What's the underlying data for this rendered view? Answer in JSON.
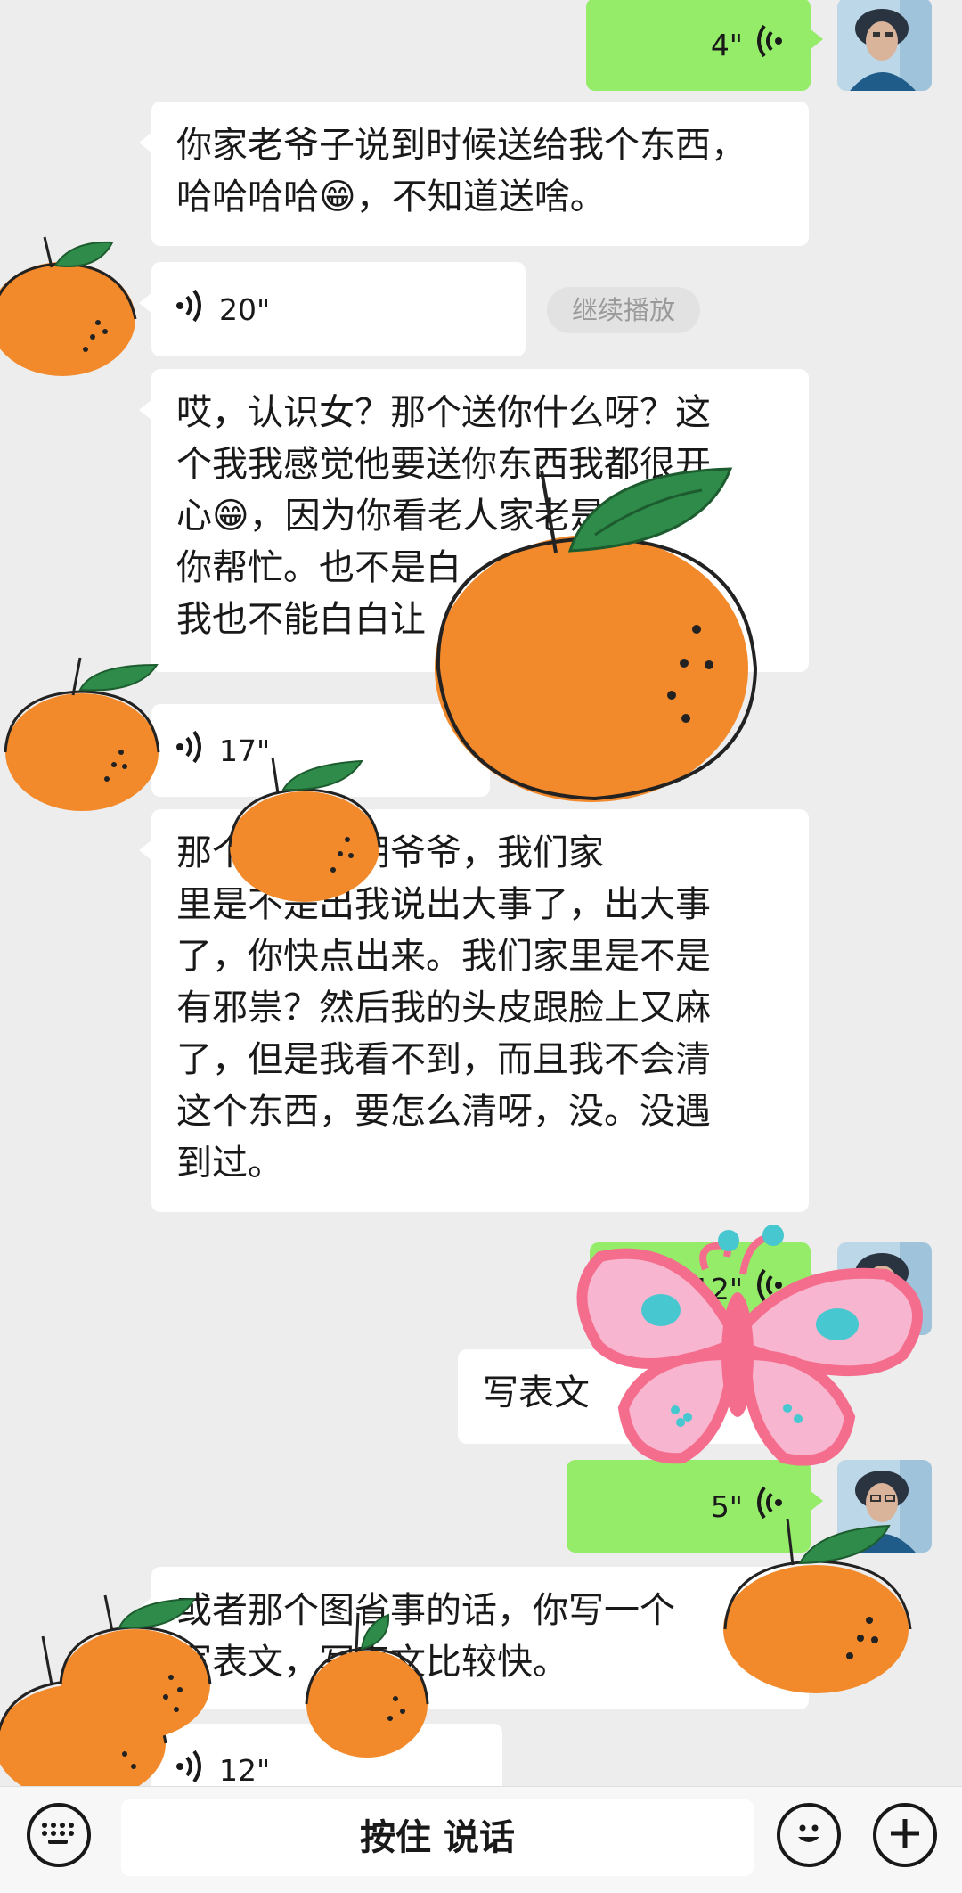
{
  "chat": {
    "messages": [
      {
        "kind": "voice",
        "side": "out",
        "duration": "4\""
      },
      {
        "kind": "text",
        "side": "in",
        "text": "你家老爷子说到时候送给我个东西，\n哈哈哈哈😁，不知道送啥。"
      },
      {
        "kind": "voice",
        "side": "in",
        "duration": "20\"",
        "continue_label": "继续播放"
      },
      {
        "kind": "text",
        "side": "in",
        "text": "哎，认识女？那个送你什么呀？这\n个我我感觉他要送你东西我都很开\n心😁，因为你看老人家老是家请\n你帮忙。也不是白\n我也不能白白让"
      },
      {
        "kind": "voice",
        "side": "in",
        "duration": "17\""
      },
      {
        "kind": "text",
        "side": "in",
        "text": "那个我一问胡爷爷，我们家\n里是不是出我说出大事了，出大事\n了，你快点出来。我们家里是不是\n有邪祟？然后我的头皮跟脸上又麻\n了，但是我看不到，而且我不会清\n这个东西，要怎么清呀，没。没遇\n到过。"
      },
      {
        "kind": "voice",
        "side": "out",
        "duration": "12\""
      },
      {
        "kind": "text",
        "side": "out",
        "text": "写表文"
      },
      {
        "kind": "voice",
        "side": "out",
        "duration": "5\""
      },
      {
        "kind": "text",
        "side": "in",
        "text": "或者那个图省事的话，你写一个\n写表文，写表文比较快。"
      },
      {
        "kind": "voice",
        "side": "in",
        "duration": "12\""
      }
    ]
  },
  "input_bar": {
    "talk_label": "按住 说话",
    "left_icon": "keyboard-icon",
    "emoji_icon": "emoji-icon",
    "plus_icon": "plus-icon"
  },
  "colors": {
    "background": "#ededed",
    "out_bubble": "#95ec69",
    "in_bubble": "#ffffff",
    "orange": "#f28a2c",
    "leaf": "#2e8b4a",
    "butterfly_pink": "#f56d8d",
    "butterfly_light": "#f7b5cf",
    "butterfly_dot": "#47c7cf"
  }
}
